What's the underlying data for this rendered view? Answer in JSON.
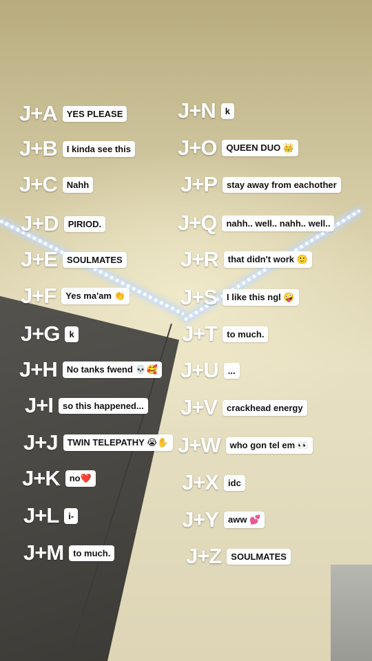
{
  "pairs": [
    {
      "tag": "J+A",
      "text": "YES PLEASE"
    },
    {
      "tag": "J+B",
      "text": "I kinda see this"
    },
    {
      "tag": "J+C",
      "text": "Nahh"
    },
    {
      "tag": "J+D",
      "text": "PIRIOD."
    },
    {
      "tag": "J+E",
      "text": "SOULMATES"
    },
    {
      "tag": "J+F",
      "text": "Yes ma'am 👏"
    },
    {
      "tag": "J+G",
      "text": "k"
    },
    {
      "tag": "J+H",
      "text": "No tanks fwend 💀🥰"
    },
    {
      "tag": "J+I",
      "text": "so this happened..."
    },
    {
      "tag": "J+J",
      "text": "TWIN TELEPATHY 😭✋"
    },
    {
      "tag": "J+K",
      "text": "no❤️"
    },
    {
      "tag": "J+L",
      "text": "i-"
    },
    {
      "tag": "J+M",
      "text": "to much."
    },
    {
      "tag": "J+N",
      "text": "k"
    },
    {
      "tag": "J+O",
      "text": "QUEEN DUO 👑"
    },
    {
      "tag": "J+P",
      "text": "stay away from eachother"
    },
    {
      "tag": "J+Q",
      "text": "nahh.. well.. nahh.. well.."
    },
    {
      "tag": "J+R",
      "text": "that didn't work 🙂"
    },
    {
      "tag": "J+S",
      "text": "I like this ngl 🤪"
    },
    {
      "tag": "J+T",
      "text": "to much."
    },
    {
      "tag": "J+U",
      "text": "..."
    },
    {
      "tag": "J+V",
      "text": "crackhead energy"
    },
    {
      "tag": "J+W",
      "text": "who gon tel em 👀"
    },
    {
      "tag": "J+X",
      "text": "idc"
    },
    {
      "tag": "J+Y",
      "text": "aww 💕"
    },
    {
      "tag": "J+Z",
      "text": "SOULMATES"
    }
  ]
}
